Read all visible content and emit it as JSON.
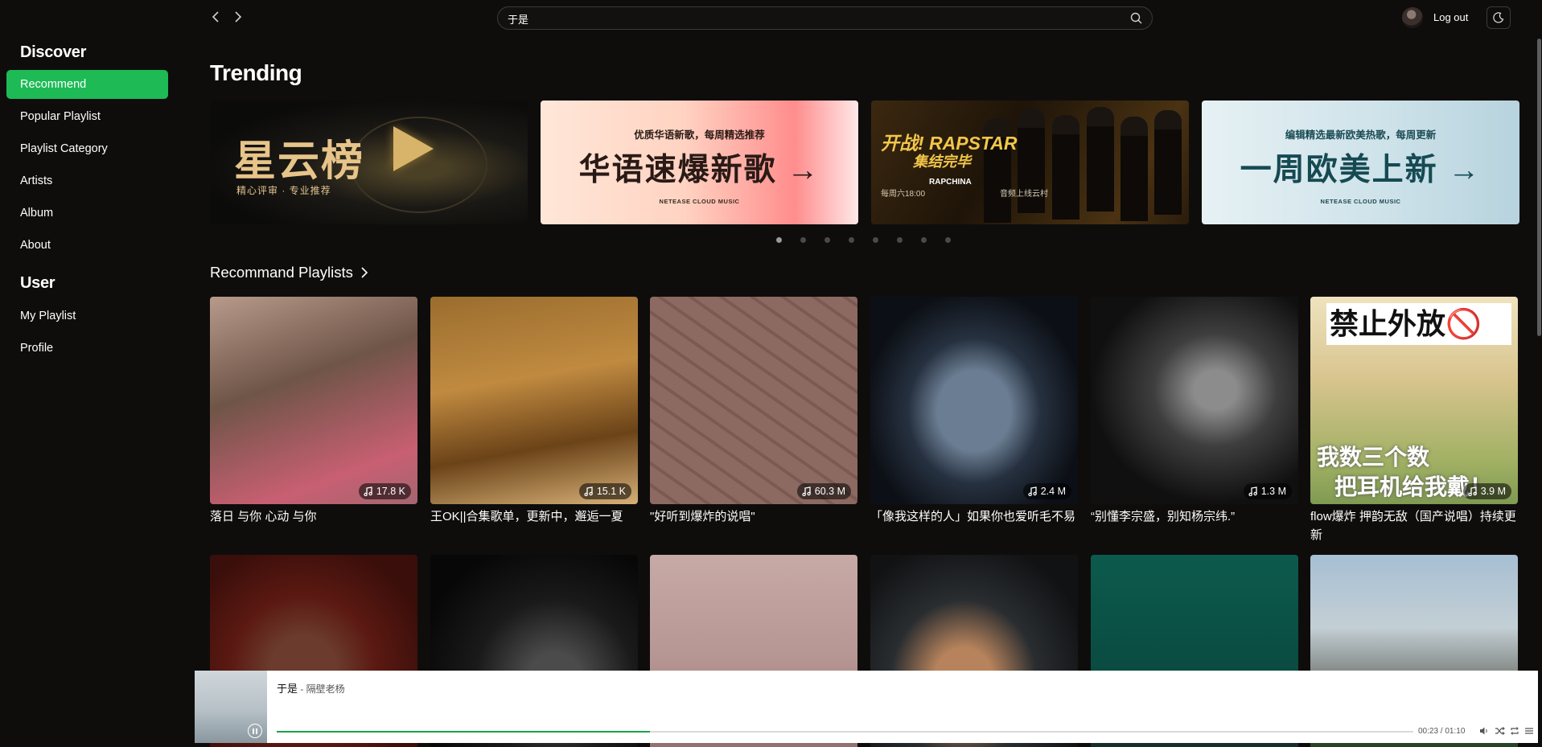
{
  "sidebar": {
    "discover_title": "Discover",
    "discover_items": [
      {
        "label": "Recommend",
        "active": true
      },
      {
        "label": "Popular Playlist",
        "active": false
      },
      {
        "label": "Playlist Category",
        "active": false
      },
      {
        "label": "Artists",
        "active": false
      },
      {
        "label": "Album",
        "active": false
      },
      {
        "label": "About",
        "active": false
      }
    ],
    "user_title": "User",
    "user_items": [
      {
        "label": "My Playlist"
      },
      {
        "label": "Profile"
      }
    ]
  },
  "topbar": {
    "search_value": "于是",
    "logout_label": "Log out"
  },
  "trending": {
    "title": "Trending",
    "banners": [
      {
        "title": "星云榜",
        "subtitle": "精心评审 · 专业推荐"
      },
      {
        "subtitle": "优质华语新歌，每周精选推荐",
        "title": "华语速爆新歌 →",
        "footer": "NETEASE CLOUD MUSIC"
      },
      {
        "title": "开战! RAPSTAR",
        "subtitle": "集结完毕",
        "schedule": "每周六18:00",
        "tag": "RAPCHINA",
        "note": "音频上线云村"
      },
      {
        "subtitle": "编辑精选最新欧美热歌，每周更新",
        "title": "一周欧美上新 →",
        "footer": "NETEASE CLOUD MUSIC"
      }
    ],
    "dot_count": 8,
    "active_dot": 0
  },
  "recommend": {
    "title": "Recommand Playlists",
    "playlists": [
      {
        "title": "落日 与你 心动 与你",
        "plays": "17.8 K"
      },
      {
        "title": "王OK||合集歌单，更新中，邂逅一夏",
        "plays": "15.1 K"
      },
      {
        "title": "\"好听到爆炸的说唱\"",
        "plays": "60.3 M"
      },
      {
        "title": "「像我这样的人」如果你也爱听毛不易",
        "plays": "2.4 M"
      },
      {
        "title": "“别懂李宗盛，别知杨宗纬.”",
        "plays": "1.3 M"
      },
      {
        "title": "flow爆炸 押韵无敌（国产说唱）持续更新",
        "plays": "3.9 M",
        "cover_text": {
          "sign": "禁止外放🚫",
          "line1": "我数三个数",
          "line2": "把耳机给我戴！"
        }
      },
      {
        "title": "",
        "plays": ""
      },
      {
        "title": "",
        "plays": ""
      },
      {
        "title": "",
        "plays": ""
      },
      {
        "title": "",
        "plays": ""
      },
      {
        "title": "",
        "plays": ""
      },
      {
        "title": "",
        "plays": ""
      }
    ]
  },
  "player": {
    "song": "于是",
    "artist": " - 隔壁老杨",
    "time": "00:23 / 01:10",
    "progress": 0.3286
  },
  "colors": {
    "accent": "#1dba55",
    "background": "#0f0d0c",
    "progress": "#1aa24a"
  }
}
